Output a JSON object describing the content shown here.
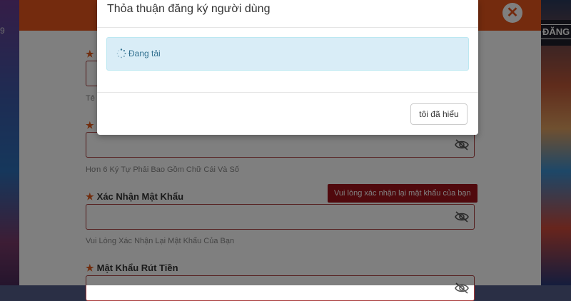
{
  "background": {
    "left_text": "9",
    "right_button_label": "ĐĂNG"
  },
  "registration": {
    "close_icon": "close-icon",
    "help_username": "Tê",
    "help_password": "Hơn 6 Ký Tự Phải Bao Gồm Chữ Cái Và Số",
    "confirm_label": "Xác Nhận Mật Khẩu",
    "confirm_tooltip": "Vui lòng xác nhận lại mật khẩu của bạn",
    "help_confirm": "Vui Lòng Xác Nhận Lại Mật Khẩu Của Bạn",
    "withdraw_label": "Mật Khẩu Rút Tiền",
    "eye_icon": "eye-slash-icon"
  },
  "modal": {
    "title": "Thỏa thuận đăng ký người dùng",
    "loading_text": "Đang tải",
    "spinner_icon": "spinner-icon",
    "ok_button": "tôi đã hiểu"
  },
  "colors": {
    "accent": "#e8571c",
    "error": "#a1121b",
    "info_bg": "#d9edf7",
    "info_text": "#31708f"
  }
}
